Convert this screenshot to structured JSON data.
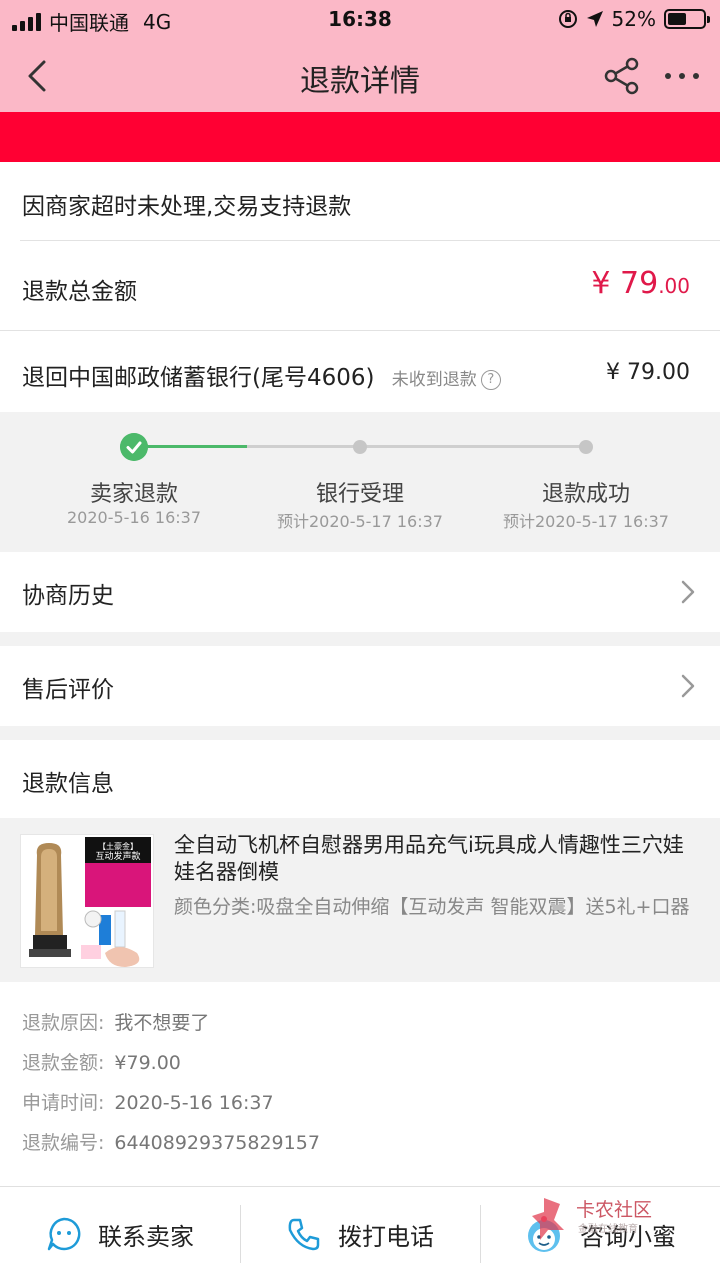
{
  "status_bar": {
    "carrier": "中国联通",
    "network": "4G",
    "time": "16:38",
    "battery": "52%",
    "battery_level": 0.52
  },
  "nav": {
    "title": "退款详情"
  },
  "reason_line": "因商家超时未处理,交易支持退款",
  "total": {
    "label": "退款总金额",
    "amount_main": "¥ 79",
    "amount_decimal": ".00"
  },
  "bank": {
    "label": "退回中国邮政储蓄银行(尾号4606)",
    "hint": "未收到退款",
    "hint_icon": "?",
    "amount": "¥ 79.00"
  },
  "progress": {
    "steps": [
      {
        "label": "卖家退款",
        "time": "2020-5-16 16:37",
        "done": true
      },
      {
        "label": "银行受理",
        "time": "预计2020-5-17 16:37",
        "done": false
      },
      {
        "label": "退款成功",
        "time": "预计2020-5-17 16:37",
        "done": false
      }
    ],
    "colors": {
      "done": "#4cb96a",
      "pending": "#c6c6c6"
    }
  },
  "menu": {
    "history": "协商历史",
    "review": "售后评价"
  },
  "refund_info": {
    "title": "退款信息",
    "product": {
      "title": "全自动飞机杯自慰器男用品充气i玩具成人情趣性三穴娃娃名器倒模",
      "spec": "颜色分类:吸盘全自动伸缩【互动发声 智能双震】送5礼+口器",
      "thumb_badge": "【土豪金】",
      "thumb_banner": "互动发声款"
    },
    "details": [
      {
        "label": "退款原因:",
        "value": "我不想要了"
      },
      {
        "label": "退款金额:",
        "value": "¥79.00"
      },
      {
        "label": "申请时间:",
        "value": "2020-5-16 16:37"
      },
      {
        "label": "退款编号:",
        "value": "64408929375829157"
      }
    ]
  },
  "bottom_bar": {
    "contact_seller": "联系卖家",
    "call": "拨打电话",
    "consult": "咨询小蜜"
  },
  "watermark": {
    "text": "卡农社区",
    "sub": "金融在线教育"
  },
  "colors": {
    "header_pink": "#fbb8c7",
    "red_banner": "#ff0033",
    "price_red": "#e0194a",
    "icon_blue": "#1e9bd8"
  }
}
